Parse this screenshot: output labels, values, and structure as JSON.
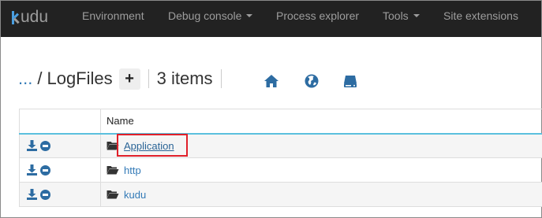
{
  "navbar": {
    "brand": "udu",
    "items": [
      {
        "label": "Environment",
        "dropdown": false
      },
      {
        "label": "Debug console",
        "dropdown": true
      },
      {
        "label": "Process explorer",
        "dropdown": false
      },
      {
        "label": "Tools",
        "dropdown": true
      },
      {
        "label": "Site extensions",
        "dropdown": false
      }
    ]
  },
  "path": {
    "parent": "...",
    "divider": "/",
    "current": "LogFiles",
    "add_label": "+",
    "count": "3 items"
  },
  "toolbar": {
    "icons": [
      "home-icon",
      "globe-icon",
      "drive-icon"
    ]
  },
  "table": {
    "column_name": "Name",
    "rows": [
      {
        "name": "Application",
        "highlighted": true
      },
      {
        "name": "http",
        "highlighted": false
      },
      {
        "name": "kudu",
        "highlighted": false
      }
    ]
  },
  "colors": {
    "navbar": "#222222",
    "link": "#337ab7",
    "icon": "#2d6ca2",
    "accent_border": "#5bc0de",
    "highlight": "#e0202a"
  }
}
